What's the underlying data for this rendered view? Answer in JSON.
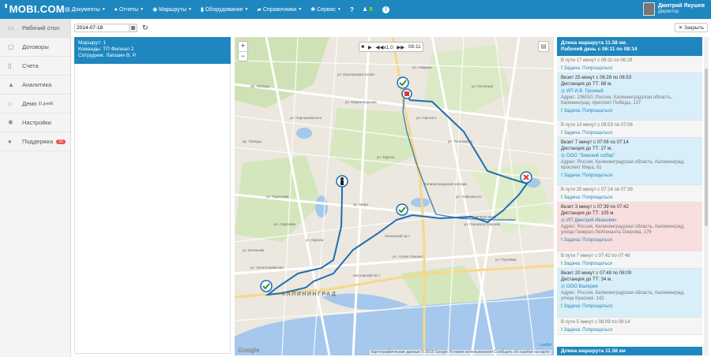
{
  "app": {
    "logo": "MOBI.COM"
  },
  "menu": [
    {
      "label": "Документы",
      "icon": "document-icon",
      "glyph": "▤"
    },
    {
      "label": "Отчеты",
      "icon": "chat-icon",
      "glyph": "●"
    },
    {
      "label": "Маршруты",
      "icon": "globe-icon",
      "glyph": "◉"
    },
    {
      "label": "Оборудование",
      "icon": "mobile-icon",
      "glyph": "▮"
    },
    {
      "label": "Справочники",
      "icon": "book-icon",
      "glyph": "▰"
    },
    {
      "label": "Сервис",
      "icon": "gear-icon",
      "glyph": "✱"
    }
  ],
  "top_icons": {
    "help": "?",
    "users_badge": "2",
    "info": "!"
  },
  "user": {
    "name": "Дмитрий Якушев",
    "role": "Директор"
  },
  "sidebar": [
    {
      "label": "Рабочий стол",
      "icon": "desktop-icon",
      "glyph": "▭"
    },
    {
      "label": "Договоры",
      "icon": "folder-icon",
      "glyph": "▢"
    },
    {
      "label": "Счета",
      "icon": "file-icon",
      "glyph": "▯"
    },
    {
      "label": "Аналитика",
      "icon": "chart-icon",
      "glyph": "▲"
    },
    {
      "label": "Демо",
      "sub": "(0 дней)",
      "icon": "bank-icon",
      "glyph": "⌂"
    },
    {
      "label": "Настройки",
      "icon": "settings-icon",
      "glyph": "✱"
    },
    {
      "label": "Поддержка",
      "badge": "10",
      "icon": "comments-icon",
      "glyph": "●"
    }
  ],
  "toolbar": {
    "date": "2014-07-18",
    "close_label": "Закрыть"
  },
  "route_info": {
    "line1": "Маршрут: 1",
    "line2": "Команды: ТП Филиал 2",
    "line3": "Сотрудник: Лапшин В. Р."
  },
  "player": {
    "speed": "x1.0",
    "time": "06:11"
  },
  "map": {
    "city": "КАЛИНИНГРАД",
    "google": "Google",
    "copyright": "Картографические данные © 2015 Google   Условия использования   Сообщить об ошибке на карте",
    "leaflet": "Leaflet",
    "labels": [
      "ул. Гайдара",
      "ул. Марии Борзова",
      "Калининградский зоопарк",
      "пр. Мира",
      "ул. Сергеева",
      "ул. Горького",
      "ул. Генерала Озерова",
      "ул. Фрунзе",
      "Московский пр-т",
      "ул. Аллея Смелых",
      "ул. Печатная",
      "Ленинский пр-т",
      "ФГБОУ ВПО",
      "пр. Победы",
      "ул. Артиллерийская",
      "ул. Толстикова",
      "ул. Кирова",
      "ул. Тургенева",
      "ул. Беланова",
      "ул. Каштановая аллея",
      "ул. Чайковского",
      "пр. Победы",
      "ул. Пугачёва",
      "ул. Чернышевского"
    ]
  },
  "timeline": {
    "header1": "Длина маршрута 11.58 км.",
    "header2": "Рабочий день с 06:11 по 08:14",
    "footer": "Длина маршрута 11.58 км",
    "task_label": "Задача: Попрощаться",
    "items": [
      {
        "kind": "travel",
        "text": "В пути 17 минут с 06:11 по 06:28"
      },
      {
        "kind": "visit",
        "line1": "Визит 25 минут с 06:28 по 06:53",
        "line2": "Дистанция до ТТ: 88 м.",
        "org": "ИП И.В. Грозный",
        "addr": "Адрес: 236010, Россия, Калининградская область, Калининград, проспект Победы, 137"
      },
      {
        "kind": "travel",
        "text": "В пути 14 минут с 06:53 по 07:06"
      },
      {
        "kind": "visit",
        "line1": "Визит 7 минут с 07:06 по 07:14",
        "line2": "Дистанция до ТТ: 27 м.",
        "org": "ООО \"Земский собор\"",
        "addr": "Адрес: Россия, Калининградская область, Калининград, проспект Мира, 61"
      },
      {
        "kind": "travel",
        "text": "В пути 25 минут с 07:14 по 07:39"
      },
      {
        "kind": "late",
        "line1": "Визит 3 минут с 07:39 по 07:42",
        "line2": "Дистанция до ТТ: 105 м.",
        "org": "ИП Дмитрий Иванович",
        "addr": "Адрес: Россия, Калининградская область, Калининград, улица Генерал-Лейтенанта Озерова, 176"
      },
      {
        "kind": "travel",
        "text": "В пути 7 минут с 07:42 по 07:48"
      },
      {
        "kind": "visit",
        "line1": "Визит 20 минут с 07:48 по 08:09",
        "line2": "Дистанция до ТТ: 34 м.",
        "org": "ООО Валерия",
        "addr": "Адрес: Россия, Калининградская область, Калининград, улица Красная, 142"
      },
      {
        "kind": "travel",
        "text": "В пути 5 минут с 08:09 по 08:14"
      }
    ]
  },
  "colors": {
    "brand": "#1f87bf",
    "route": "#1f6fb0",
    "success": "#2e9444",
    "danger": "#d93b3b"
  }
}
